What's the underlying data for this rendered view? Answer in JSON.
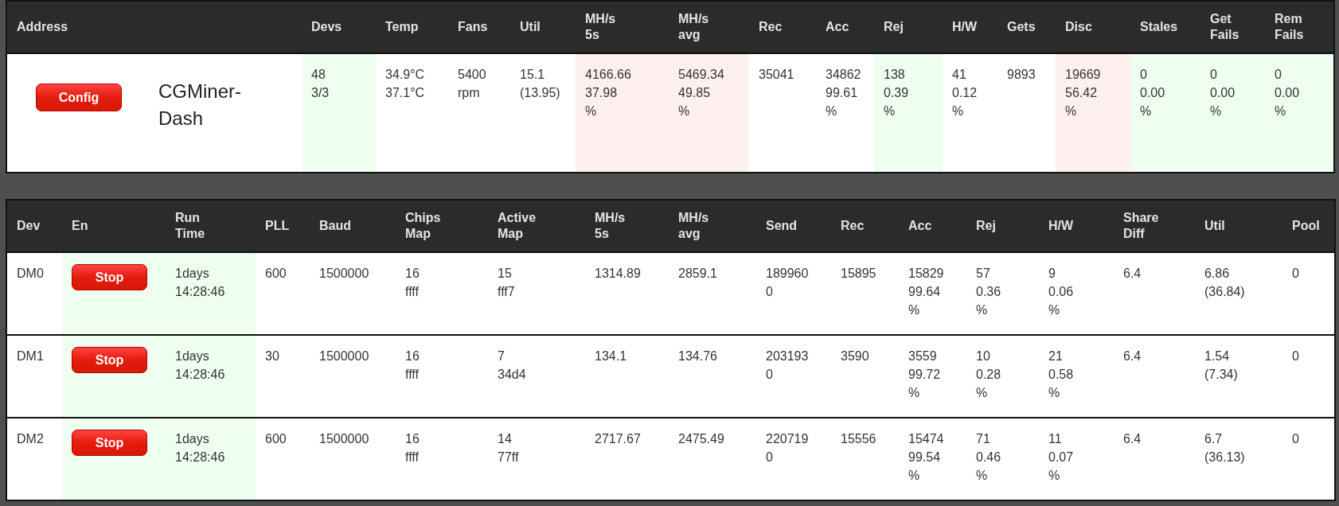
{
  "miner_table": {
    "columns": [
      "Address",
      "Devs",
      "Temp",
      "Fans",
      "Util",
      "MH/s\n5s",
      "MH/s\navg",
      "Rec",
      "Acc",
      "Rej",
      "H/W",
      "Gets",
      "Disc",
      "Stales",
      "Get\nFails",
      "Rem\nFails"
    ],
    "rows": [
      {
        "cells": [
          {
            "kind": "address",
            "button": "Config",
            "name": "CGMiner-Dash"
          },
          {
            "kind": "text",
            "lines": [
              "48",
              "3/3"
            ],
            "color": "#efffef"
          },
          {
            "kind": "text",
            "lines": [
              "34.9°C",
              "37.1°C"
            ]
          },
          {
            "kind": "text",
            "lines": [
              "5400",
              "rpm"
            ]
          },
          {
            "kind": "text",
            "lines": [
              "15.1",
              "(13.95)"
            ]
          },
          {
            "kind": "text",
            "lines": [
              "4166.66",
              "37.98",
              "%"
            ],
            "color": "#fff0f0"
          },
          {
            "kind": "text",
            "lines": [
              "5469.34",
              "49.85",
              "%"
            ],
            "color": "#fff0f0"
          },
          {
            "kind": "text",
            "lines": [
              "35041"
            ]
          },
          {
            "kind": "text",
            "lines": [
              "34862",
              "99.61",
              "%"
            ]
          },
          {
            "kind": "text",
            "lines": [
              "138",
              "0.39",
              "%"
            ],
            "color": "#efffef"
          },
          {
            "kind": "text",
            "lines": [
              "41",
              "0.12",
              "%"
            ]
          },
          {
            "kind": "text",
            "lines": [
              "9893"
            ]
          },
          {
            "kind": "text",
            "lines": [
              "19669",
              "56.42",
              "%"
            ],
            "color": "#fff0f0"
          },
          {
            "kind": "text",
            "lines": [
              "0",
              "0.00",
              "%"
            ],
            "color": "#efffef"
          },
          {
            "kind": "text",
            "lines": [
              "0",
              "0.00",
              "%"
            ],
            "color": "#efffef"
          },
          {
            "kind": "text",
            "lines": [
              "0",
              "0.00",
              "%"
            ],
            "color": "#efffef"
          }
        ]
      }
    ]
  },
  "device_table": {
    "columns": [
      "Dev",
      "En",
      "Run\nTime",
      "PLL",
      "Baud",
      "Chips\nMap",
      "Active\nMap",
      "MH/s\n5s",
      "MH/s\navg",
      "Send",
      "Rec",
      "Acc",
      "Rej",
      "H/W",
      "Share\nDiff",
      "Util",
      "Pool"
    ],
    "rows": [
      {
        "cells": [
          {
            "kind": "text",
            "lines": [
              "DM0"
            ]
          },
          {
            "kind": "button",
            "button": "Stop",
            "color": "#efffef"
          },
          {
            "kind": "text",
            "lines": [
              "1days",
              "14:28:46"
            ],
            "color": "#efffef"
          },
          {
            "kind": "text",
            "lines": [
              "600"
            ]
          },
          {
            "kind": "text",
            "lines": [
              "1500000"
            ]
          },
          {
            "kind": "text",
            "lines": [
              "16",
              "ffff"
            ]
          },
          {
            "kind": "text",
            "lines": [
              "15",
              "fff7"
            ]
          },
          {
            "kind": "text",
            "lines": [
              "1314.89"
            ]
          },
          {
            "kind": "text",
            "lines": [
              "2859.1"
            ]
          },
          {
            "kind": "text",
            "lines": [
              "189960",
              "0"
            ]
          },
          {
            "kind": "text",
            "lines": [
              "15895"
            ]
          },
          {
            "kind": "text",
            "lines": [
              "15829",
              "99.64",
              "%"
            ]
          },
          {
            "kind": "text",
            "lines": [
              "57",
              "0.36",
              "%"
            ]
          },
          {
            "kind": "text",
            "lines": [
              "9",
              "0.06",
              "%"
            ]
          },
          {
            "kind": "text",
            "lines": [
              "6.4"
            ]
          },
          {
            "kind": "text",
            "lines": [
              "6.86",
              "(36.84)"
            ]
          },
          {
            "kind": "text",
            "lines": [
              "0"
            ]
          }
        ]
      },
      {
        "cells": [
          {
            "kind": "text",
            "lines": [
              "DM1"
            ]
          },
          {
            "kind": "button",
            "button": "Stop",
            "color": "#efffef"
          },
          {
            "kind": "text",
            "lines": [
              "1days",
              "14:28:46"
            ],
            "color": "#efffef"
          },
          {
            "kind": "text",
            "lines": [
              "30"
            ]
          },
          {
            "kind": "text",
            "lines": [
              "1500000"
            ]
          },
          {
            "kind": "text",
            "lines": [
              "16",
              "ffff"
            ]
          },
          {
            "kind": "text",
            "lines": [
              "7",
              "34d4"
            ]
          },
          {
            "kind": "text",
            "lines": [
              "134.1"
            ]
          },
          {
            "kind": "text",
            "lines": [
              "134.76"
            ]
          },
          {
            "kind": "text",
            "lines": [
              "203193",
              "0"
            ]
          },
          {
            "kind": "text",
            "lines": [
              "3590"
            ]
          },
          {
            "kind": "text",
            "lines": [
              "3559",
              "99.72",
              "%"
            ]
          },
          {
            "kind": "text",
            "lines": [
              "10",
              "0.28",
              "%"
            ]
          },
          {
            "kind": "text",
            "lines": [
              "21",
              "0.58",
              "%"
            ]
          },
          {
            "kind": "text",
            "lines": [
              "6.4"
            ]
          },
          {
            "kind": "text",
            "lines": [
              "1.54",
              "(7.34)"
            ]
          },
          {
            "kind": "text",
            "lines": [
              "0"
            ]
          }
        ]
      },
      {
        "cells": [
          {
            "kind": "text",
            "lines": [
              "DM2"
            ]
          },
          {
            "kind": "button",
            "button": "Stop",
            "color": "#efffef"
          },
          {
            "kind": "text",
            "lines": [
              "1days",
              "14:28:46"
            ],
            "color": "#efffef"
          },
          {
            "kind": "text",
            "lines": [
              "600"
            ]
          },
          {
            "kind": "text",
            "lines": [
              "1500000"
            ]
          },
          {
            "kind": "text",
            "lines": [
              "16",
              "ffff"
            ]
          },
          {
            "kind": "text",
            "lines": [
              "14",
              "77ff"
            ]
          },
          {
            "kind": "text",
            "lines": [
              "2717.67"
            ]
          },
          {
            "kind": "text",
            "lines": [
              "2475.49"
            ]
          },
          {
            "kind": "text",
            "lines": [
              "220719",
              "0"
            ]
          },
          {
            "kind": "text",
            "lines": [
              "15556"
            ]
          },
          {
            "kind": "text",
            "lines": [
              "15474",
              "99.54",
              "%"
            ]
          },
          {
            "kind": "text",
            "lines": [
              "71",
              "0.46",
              "%"
            ]
          },
          {
            "kind": "text",
            "lines": [
              "11",
              "0.07",
              "%"
            ]
          },
          {
            "kind": "text",
            "lines": [
              "6.4"
            ]
          },
          {
            "kind": "text",
            "lines": [
              "6.7",
              "(36.13)"
            ]
          },
          {
            "kind": "text",
            "lines": [
              "0"
            ]
          }
        ]
      }
    ]
  }
}
